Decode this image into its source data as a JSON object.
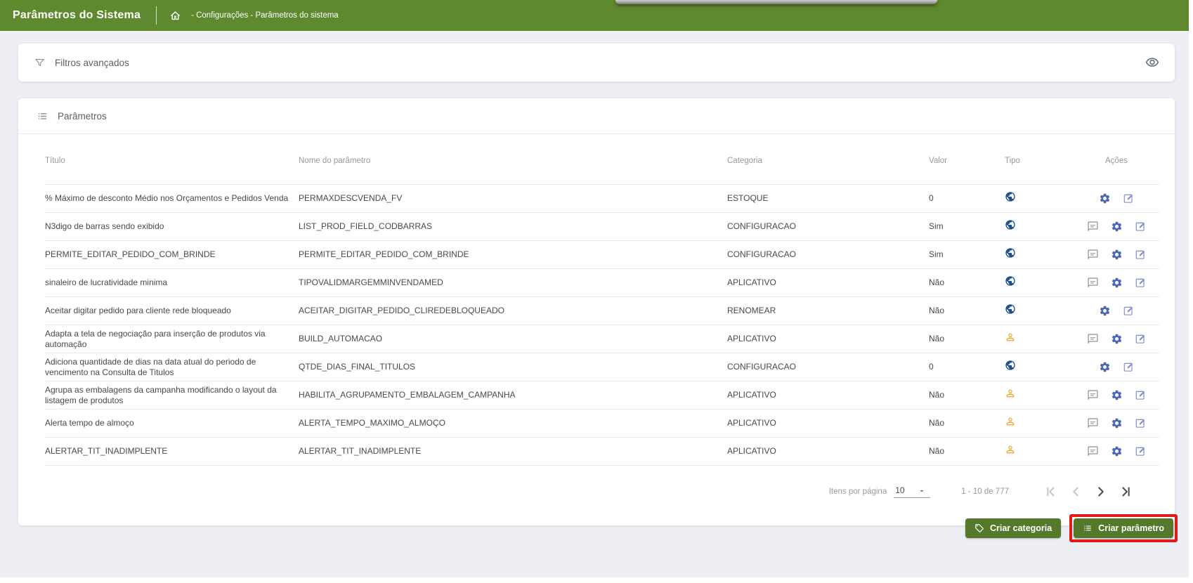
{
  "header": {
    "title": "Parâmetros do Sistema",
    "breadcrumb": "- Configurações - Parâmetros do sistema",
    "home_icon": "home-icon"
  },
  "filters_panel": {
    "title": "Filtros avançados",
    "left_icon": "filter-icon",
    "right_icon": "eye-icon"
  },
  "params_panel": {
    "title": "Parâmetros",
    "left_icon": "list-icon",
    "columns": [
      "Título",
      "Nome do parâmetro",
      "Categoria",
      "Valor",
      "Tipo",
      "Ações"
    ],
    "rows": [
      {
        "titulo": "% Máximo de desconto Médio nos Orçamentos e Pedidos Venda",
        "nome": "PERMAXDESCVENDA_FV",
        "categoria": "ESTOQUE",
        "valor": "0",
        "tipo": "global-icon",
        "acoes": [
          "settings-icon",
          "edit-icon"
        ]
      },
      {
        "titulo": "N3digo de barras sendo exibido",
        "nome": "LIST_PROD_FIELD_CODBARRAS",
        "categoria": "CONFIGURACAO",
        "valor": "Sim",
        "tipo": "global-icon",
        "acoes": [
          "comment-icon",
          "settings-icon",
          "edit-icon"
        ]
      },
      {
        "titulo": "PERMITE_EDITAR_PEDIDO_COM_BRINDE",
        "nome": "PERMITE_EDITAR_PEDIDO_COM_BRINDE",
        "categoria": "CONFIGURACAO",
        "valor": "Sim",
        "tipo": "global-icon",
        "acoes": [
          "comment-icon",
          "settings-icon",
          "edit-icon"
        ]
      },
      {
        "titulo": "sinaleiro de lucratividade minima",
        "nome": "TIPOVALIDMARGEMMINVENDAMED",
        "categoria": "APLICATIVO",
        "valor": "Não",
        "tipo": "global-icon",
        "acoes": [
          "comment-icon",
          "settings-icon",
          "edit-icon"
        ]
      },
      {
        "titulo": "Aceitar digitar pedido para cliente rede bloqueado",
        "nome": "ACEITAR_DIGITAR_PEDIDO_CLIREDEBLOQUEADO",
        "categoria": "RENOMEAR",
        "valor": "Não",
        "tipo": "global-icon",
        "acoes": [
          "settings-icon",
          "edit-icon"
        ]
      },
      {
        "titulo": "Adapta a tela de negociação para inserção de produtos via automação",
        "nome": "BUILD_AUTOMACAO",
        "categoria": "APLICATIVO",
        "valor": "Não",
        "tipo": "user-icon",
        "acoes": [
          "comment-icon",
          "settings-icon",
          "edit-icon"
        ]
      },
      {
        "titulo": "Adiciona quantidade de dias na data atual do periodo de vencimento na Consulta de Titulos",
        "nome": "QTDE_DIAS_FINAL_TITULOS",
        "categoria": "CONFIGURACAO",
        "valor": "0",
        "tipo": "global-icon",
        "acoes": [
          "settings-icon",
          "edit-icon"
        ]
      },
      {
        "titulo": "Agrupa as embalagens da campanha modificando o layout da listagem de produtos",
        "nome": "HABILITA_AGRUPAMENTO_EMBALAGEM_CAMPANHA",
        "categoria": "APLICATIVO",
        "valor": "Não",
        "tipo": "user-icon",
        "acoes": [
          "comment-icon",
          "settings-icon",
          "edit-icon"
        ]
      },
      {
        "titulo": "Alerta tempo de almoço",
        "nome": "ALERTA_TEMPO_MAXIMO_ALMOÇO",
        "categoria": "APLICATIVO",
        "valor": "Não",
        "tipo": "user-icon",
        "acoes": [
          "comment-icon",
          "settings-icon",
          "edit-icon"
        ]
      },
      {
        "titulo": "ALERTAR_TIT_INADIMPLENTE",
        "nome": "ALERTAR_TIT_INADIMPLENTE",
        "categoria": "APLICATIVO",
        "valor": "Não",
        "tipo": "user-icon",
        "acoes": [
          "comment-icon",
          "settings-icon",
          "edit-icon"
        ]
      }
    ],
    "pagination": {
      "items_per_page_label": "Itens por página",
      "items_per_page_value": "10",
      "range_label": "1 - 10 de 777",
      "nav_icons": [
        "first-page-icon",
        "prev-page-icon",
        "next-page-icon",
        "last-page-icon"
      ]
    }
  },
  "footer_actions": {
    "create_category_label": "Criar categoria",
    "create_category_icon": "tag-icon",
    "create_parameter_label": "Criar parâmetro",
    "create_parameter_icon": "list-icon",
    "highlight_note": "red-annotation-box-around-create-parameter"
  },
  "colors": {
    "header_green": "#5e892f",
    "button_green": "#55792b",
    "background_gray": "#edeff4",
    "highlight_red": "#e01a1a",
    "tipo_global_blue": "#1c4f8c",
    "tipo_user_orange": "#f5a31d",
    "action_gear_blue": "#4d66b3",
    "action_edit_blue": "#7d8fd0",
    "comment_gray": "#9aa0a6"
  }
}
